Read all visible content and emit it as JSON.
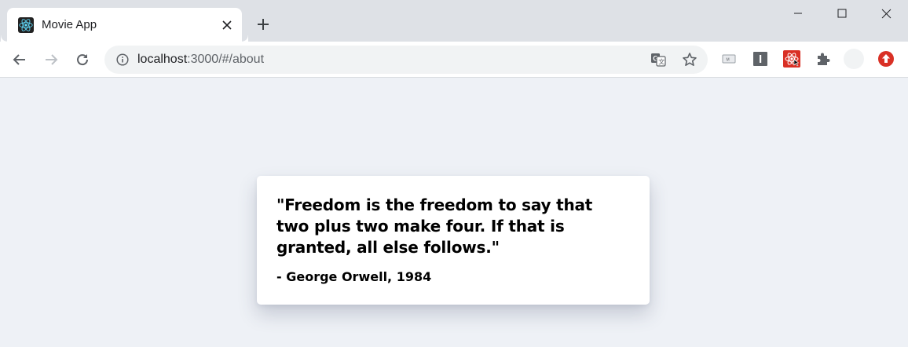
{
  "browser": {
    "tab": {
      "title": "Movie App",
      "favicon": "react-logo-icon"
    },
    "new_tab_label": "+",
    "window_controls": [
      "minimize-icon",
      "maximize-icon",
      "close-icon"
    ],
    "url": {
      "host": "localhost",
      "path": ":3000/#/about"
    },
    "omnibox_icons": [
      "translate-icon",
      "bookmark-star-icon"
    ],
    "extensions": [
      "reader-icon",
      "info-ext-icon",
      "react-devtools-icon",
      "extensions-puzzle-icon",
      "profile-avatar-icon",
      "update-icon"
    ],
    "colors": {
      "tab_strip": "#dee1e6",
      "toolbar": "#ffffff",
      "omnibox": "#f1f3f4",
      "page_background": "#eef1f6",
      "update_red": "#d93025"
    }
  },
  "page": {
    "quote": "\"Freedom is the freedom to say that two plus two make four. If that is granted, all else follows.\"",
    "author": "- George Orwell, 1984"
  }
}
